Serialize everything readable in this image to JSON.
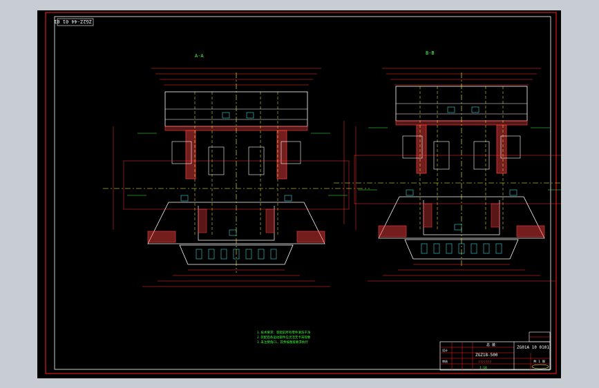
{
  "drawing": {
    "corner_code": "ZG2Z-44 01 01",
    "view_left_label": "A-A",
    "view_right_label": "B-B",
    "colors": {
      "background": "#000000",
      "frame": "#ff2020",
      "outline": "#ffffff",
      "dimension": "#ff3030",
      "centerline": "#ffff40",
      "text": "#40ff40",
      "hidden": "#40ffff",
      "hatch": "#ff4040"
    },
    "notes": [
      "1.技术要求：装配前所有零件清洗干净",
      "2.装配后各运动部件应灵活无卡滞现象",
      "3.未注倒角C1，其余按图纸要求执行"
    ],
    "title_block": {
      "drawing_no": "ZG01A 10 0101",
      "part_name": "ZGZ18-500",
      "material": "???????",
      "scale": "1:10",
      "sheet": "共 1 张",
      "designer": "设计",
      "checker": "审核",
      "label_top": "总 装"
    }
  }
}
